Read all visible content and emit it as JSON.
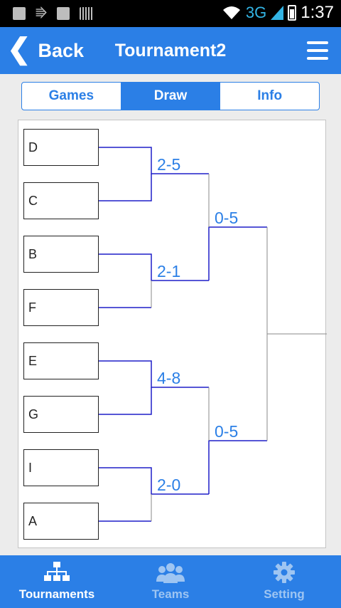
{
  "statusbar": {
    "network": "3G",
    "time": "1:37"
  },
  "appbar": {
    "back_label": "Back",
    "title": "Tournament2"
  },
  "tabs": [
    {
      "label": "Games",
      "active": false
    },
    {
      "label": "Draw",
      "active": true
    },
    {
      "label": "Info",
      "active": false
    }
  ],
  "bracket": {
    "teams": [
      "D",
      "C",
      "B",
      "F",
      "E",
      "G",
      "I",
      "A"
    ],
    "round1_scores": [
      "2-5",
      "2-1",
      "4-8",
      "2-0"
    ],
    "round2_scores": [
      "0-5",
      "0-5"
    ]
  },
  "bottomnav": {
    "items": [
      {
        "label": "Tournaments",
        "icon": "bracket-icon",
        "active": true
      },
      {
        "label": "Teams",
        "icon": "people-icon",
        "active": false
      },
      {
        "label": "Setting",
        "icon": "gear-icon",
        "active": false
      }
    ]
  },
  "colors": {
    "primary": "#2b7fe6",
    "line": "#1e1ec8",
    "connector": "#8a8a8a"
  }
}
